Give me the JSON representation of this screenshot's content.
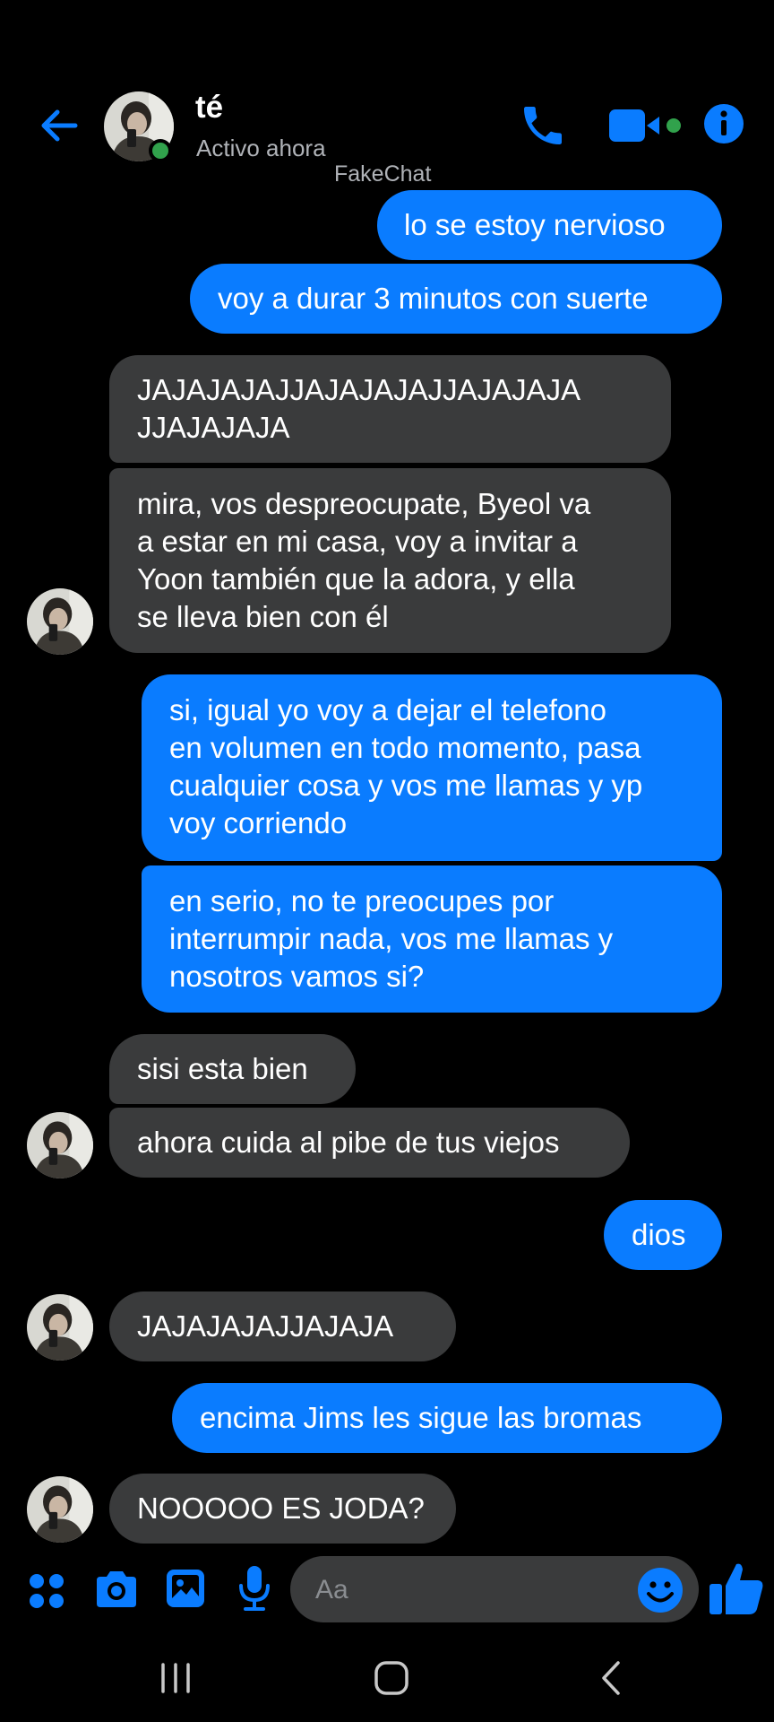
{
  "header": {
    "contact_name": "té",
    "status": "Activo ahora",
    "watermark": "FakeChat"
  },
  "messages": [
    {
      "direction": "out",
      "text": "lo se estoy nervioso"
    },
    {
      "direction": "out",
      "text": "voy a durar 3 minutos con suerte"
    },
    {
      "direction": "in",
      "text": "JAJAJAJAJJAJAJAJAJJAJAJAJA\nJJAJAJAJA"
    },
    {
      "direction": "in",
      "text": "mira, vos despreocupate, Byeol va\na estar en mi casa, voy a invitar a\nYoon también que la adora, y ella\nse lleva bien con él"
    },
    {
      "direction": "out",
      "text": "si, igual yo voy a dejar el telefono\nen volumen en todo momento, pasa\ncualquier cosa y vos me llamas y yp\nvoy corriendo"
    },
    {
      "direction": "out",
      "text": "en serio, no te preocupes por\ninterrumpir nada, vos me llamas y\nnosotros vamos si?"
    },
    {
      "direction": "in",
      "text": "sisi esta bien"
    },
    {
      "direction": "in",
      "text": "ahora cuida al pibe de tus viejos"
    },
    {
      "direction": "out",
      "text": "dios"
    },
    {
      "direction": "in",
      "text": "JAJAJAJAJJAJAJA"
    },
    {
      "direction": "out",
      "text": "encima Jims les sigue las bromas"
    },
    {
      "direction": "in",
      "text": "NOOOOO ES JODA?"
    }
  ],
  "composer": {
    "placeholder": "Aa",
    "icons": [
      "apps-icon",
      "camera-icon",
      "gallery-icon",
      "microphone-icon",
      "emoji-icon",
      "like-icon"
    ]
  },
  "nav": {
    "icons": [
      "recent-apps-icon",
      "home-icon",
      "back-icon"
    ]
  },
  "colors": {
    "accent": "#0a7cff",
    "incoming_bubble": "#3a3b3c",
    "online": "#31a24c"
  }
}
